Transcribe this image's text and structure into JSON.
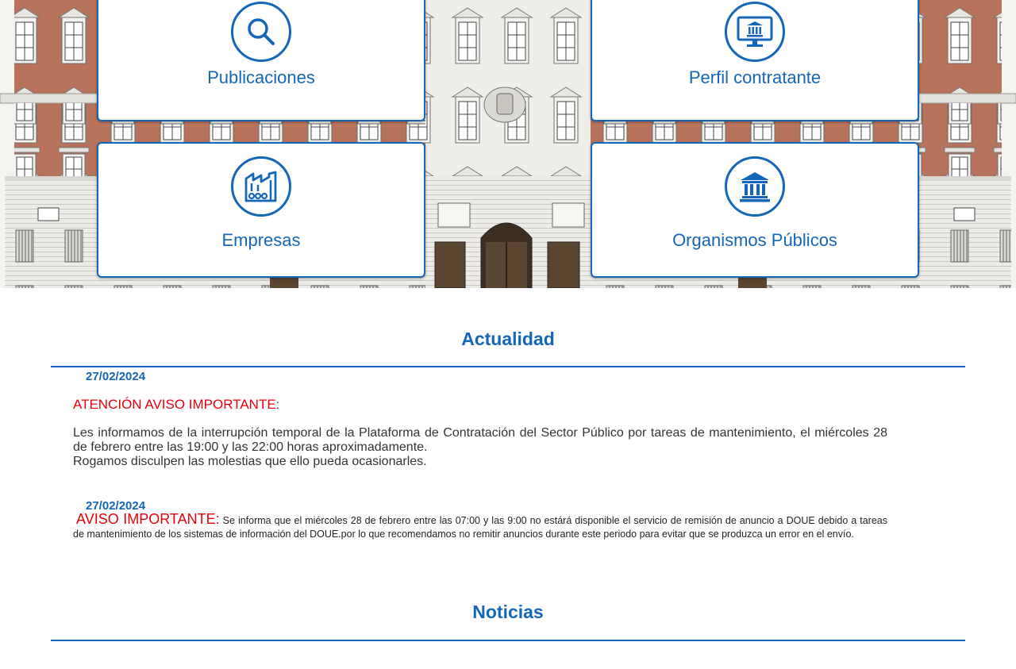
{
  "tiles": [
    {
      "label": "Publicaciones",
      "icon": "search-icon"
    },
    {
      "label": "Perfil contratante",
      "icon": "monitor-institution-icon"
    },
    {
      "label": "Empresas",
      "icon": "factory-icon"
    },
    {
      "label": "Organismos Públicos",
      "icon": "institution-icon"
    }
  ],
  "actualidad": {
    "title": "Actualidad",
    "items": [
      {
        "date": "27/02/2024",
        "alert": "ATENCIÓN AVISO IMPORTANTE",
        "alert_suffix": ":",
        "body_line1": "Les informamos de la interrupción temporal de la Plataforma de Contratación del Sector Público por tareas de mantenimiento, el miércoles 28 de febrero entre las 19:00 y las 22:00 horas aproximadamente.",
        "body_line2": "Rogamos disculpen las molestias que ello pueda ocasionarles."
      },
      {
        "date": "27/02/2024",
        "alert": "AVISO IMPORTANTE:",
        "body": "Se informa que el miércoles 28 de febrero entre las 07:00 y las 9:00 no estárá disponible el servicio de remisión de anuncio a DOUE debido a tareas de mantenimiento de los sistemas de información del DOUE.por lo que recomendamos no remitir anuncios durante este periodo para evitar que se produzca un error en el envío."
      }
    ]
  },
  "noticias": {
    "title": "Noticias"
  },
  "colors": {
    "accent": "#1466b8",
    "alert": "#e8000b",
    "facade_brick": "#b8735c",
    "facade_stone": "#eceae4"
  }
}
